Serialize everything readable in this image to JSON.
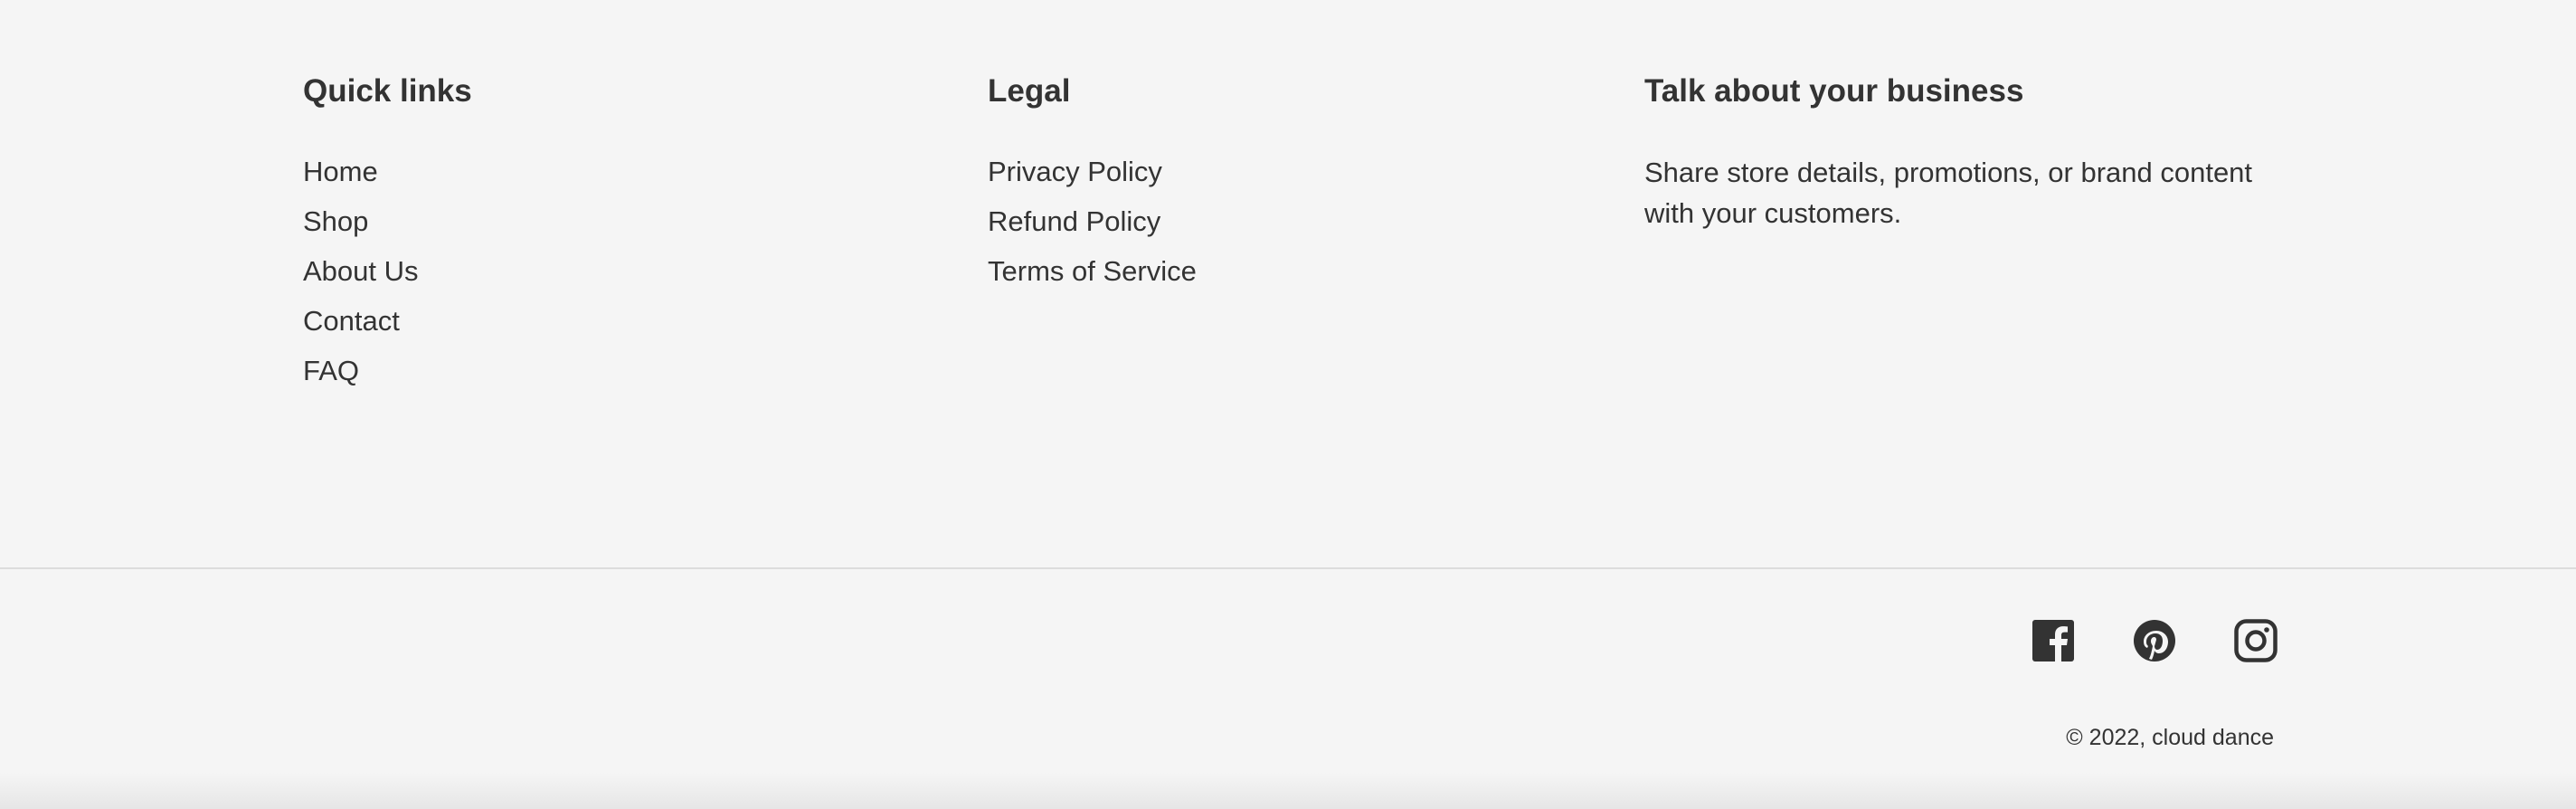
{
  "footer": {
    "quick_links": {
      "title": "Quick links",
      "items": [
        "Home",
        "Shop",
        "About Us",
        "Contact",
        "FAQ"
      ]
    },
    "legal": {
      "title": "Legal",
      "items": [
        "Privacy Policy",
        "Refund Policy",
        "Terms of Service"
      ]
    },
    "business": {
      "title": "Talk about your business",
      "text": "Share store details, promotions, or brand content with your customers."
    },
    "social": [
      {
        "icon": "facebook-icon"
      },
      {
        "icon": "pinterest-icon"
      },
      {
        "icon": "instagram-icon"
      }
    ],
    "copyright": "© 2022, cloud dance"
  },
  "colors": {
    "background": "#f5f5f5",
    "text": "#333333",
    "divider": "#dcdcdc"
  }
}
